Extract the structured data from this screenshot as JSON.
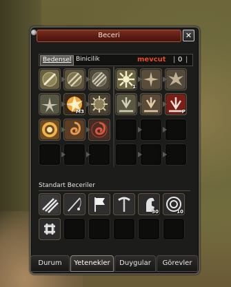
{
  "window": {
    "title": "Beceri",
    "close_label": "✕"
  },
  "subtabs": [
    {
      "label": "Bedensel",
      "active": true
    },
    {
      "label": "Binicilik",
      "active": false
    }
  ],
  "points": {
    "label": "mevcut",
    "value": "0"
  },
  "skills_left": [
    {
      "icon": "slash-sword-icon",
      "level": ""
    },
    {
      "icon": "double-slash-icon",
      "level": ""
    },
    {
      "icon": "triple-slash-icon",
      "level": ""
    },
    {
      "icon": "spike-sword-icon",
      "level": ""
    },
    {
      "icon": "explosion-sword-icon",
      "level": "M3"
    },
    {
      "icon": "spiked-burst-icon",
      "level": ""
    },
    {
      "icon": "fire-ring-icon",
      "level": ""
    },
    {
      "icon": "spiral-flame-icon",
      "level": ""
    },
    {
      "icon": "red-spiral-icon",
      "level": ""
    }
  ],
  "skills_right": [
    {
      "icon": "sunburst-icon",
      "level": "1"
    },
    {
      "icon": "blade-star-icon",
      "level": ""
    },
    {
      "icon": "blade-star-2-icon",
      "level": ""
    },
    {
      "icon": "ground-burst-icon",
      "level": ""
    },
    {
      "icon": "red-ground-burst-icon",
      "level": ""
    },
    {
      "icon": "red-fountain-icon",
      "level": "P"
    }
  ],
  "standard_section": {
    "label": "Standart Beceriler"
  },
  "standard_skills": [
    {
      "icon": "claw-strike-icon",
      "level": ""
    },
    {
      "icon": "fishing-rod-icon",
      "level": ""
    },
    {
      "icon": "white-flag-icon",
      "level": ""
    },
    {
      "icon": "pickaxe-icon",
      "level": ""
    },
    {
      "icon": "horse-icon",
      "level": "30"
    },
    {
      "icon": "scroll-seal-icon",
      "level": "10"
    },
    {
      "icon": "celtic-knot-icon",
      "level": ""
    }
  ],
  "bottom_tabs": [
    {
      "label": "Durum",
      "active": false
    },
    {
      "label": "Yetenekler",
      "active": true
    },
    {
      "label": "Duygular",
      "active": false
    },
    {
      "label": "Görevler",
      "active": false
    }
  ],
  "colors": {
    "accent": "#e24c1f",
    "title_bar": "#5a1b12"
  }
}
